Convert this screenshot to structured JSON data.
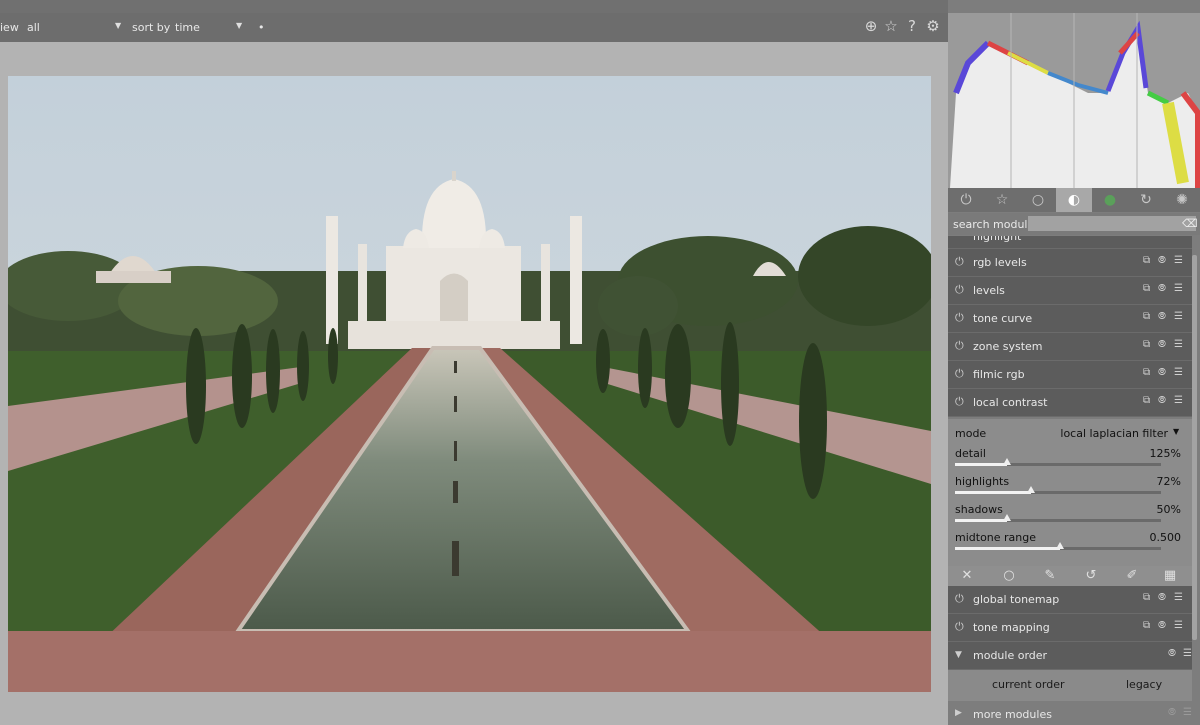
{
  "topbar": {
    "view_label": "iew",
    "view_value": "all",
    "sort_label": "sort by",
    "sort_value": "time",
    "dot": "•"
  },
  "search": {
    "label": "search module",
    "placeholder": "",
    "value": ""
  },
  "tabs": [
    {
      "icon": "power-icon",
      "glyph": "⏻"
    },
    {
      "icon": "favorites-star-icon",
      "glyph": "☆"
    },
    {
      "icon": "circle-icon",
      "glyph": "○"
    },
    {
      "icon": "tone-half-circle-icon",
      "glyph": "◐"
    },
    {
      "icon": "color-ball-icon",
      "glyph": "●"
    },
    {
      "icon": "correct-cycle-icon",
      "glyph": "↻"
    },
    {
      "icon": "effects-aperture-icon",
      "glyph": "✺"
    }
  ],
  "modules": [
    {
      "label": "rgb levels"
    },
    {
      "label": "levels"
    },
    {
      "label": "tone curve"
    },
    {
      "label": "zone system"
    },
    {
      "label": "filmic rgb"
    },
    {
      "label": "local contrast"
    }
  ],
  "partial_module_label": "highlight",
  "local_contrast": {
    "mode_label": "mode",
    "mode_value": "local laplacian filter",
    "sliders": [
      {
        "label": "detail",
        "value": "125%",
        "level": 0.25
      },
      {
        "label": "highlights",
        "value": "72%",
        "level": 0.36
      },
      {
        "label": "shadows",
        "value": "50%",
        "level": 0.25
      },
      {
        "label": "midtone range",
        "value": "0.500",
        "level": 0.5
      }
    ]
  },
  "modules_after": [
    {
      "label": "global tonemap"
    },
    {
      "label": "tone mapping"
    }
  ],
  "module_order": {
    "label": "module order",
    "current": "current order",
    "legacy": "legacy"
  },
  "more_modules": "more modules",
  "colors": {
    "sky": "#c8d3dc",
    "marble": "#ebe7e1",
    "grass": "#3c5a2a",
    "tree": "#2b3a20",
    "water": "#5b6a5a",
    "path": "#9a6a5e",
    "histogram_fill": "#e8e8e8"
  }
}
